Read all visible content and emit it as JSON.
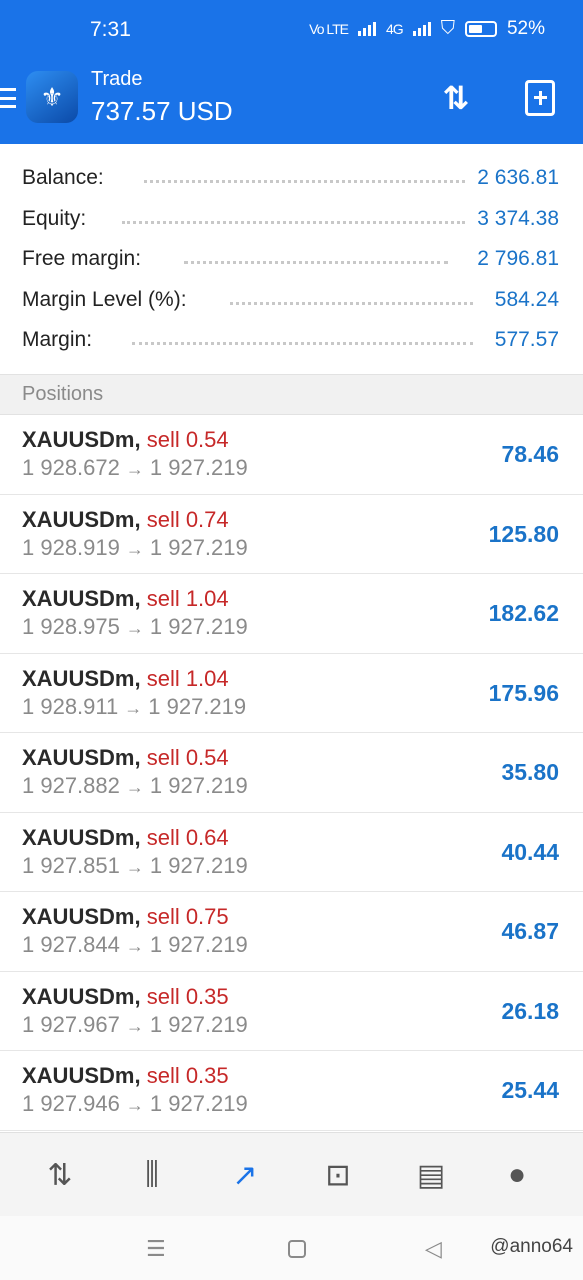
{
  "status_bar": {
    "time": "7:31",
    "network_icon": "volte-icon",
    "network_label": "Vo LTE",
    "network_type": "4G",
    "battery": "52%"
  },
  "header": {
    "title": "Trade",
    "value": "737.57 USD",
    "menu_icon": "hamburger-menu-icon",
    "sort_icon": "sort-arrows-icon",
    "new_order_icon": "new-order-icon"
  },
  "summary": [
    {
      "label": "Balance:",
      "value": "2 636.81"
    },
    {
      "label": "Equity:",
      "value": "3 374.38"
    },
    {
      "label": "Free margin:",
      "value": "2 796.81"
    },
    {
      "label": "Margin Level (%):",
      "value": "584.24"
    },
    {
      "label": "Margin:",
      "value": "577.57"
    }
  ],
  "positions_header": "Positions",
  "positions": [
    {
      "symbol": "XAUUSDm,",
      "direction": "sell 0.54",
      "open": "1 928.672",
      "arrow": "→",
      "current": "1 927.219",
      "profit": "78.46"
    },
    {
      "symbol": "XAUUSDm,",
      "direction": "sell 0.74",
      "open": "1 928.919",
      "arrow": "→",
      "current": "1 927.219",
      "profit": "125.80"
    },
    {
      "symbol": "XAUUSDm,",
      "direction": "sell 1.04",
      "open": "1 928.975",
      "arrow": "→",
      "current": "1 927.219",
      "profit": "182.62"
    },
    {
      "symbol": "XAUUSDm,",
      "direction": "sell 1.04",
      "open": "1 928.911",
      "arrow": "→",
      "current": "1 927.219",
      "profit": "175.96"
    },
    {
      "symbol": "XAUUSDm,",
      "direction": "sell 0.54",
      "open": "1 927.882",
      "arrow": "→",
      "current": "1 927.219",
      "profit": "35.80"
    },
    {
      "symbol": "XAUUSDm,",
      "direction": "sell 0.64",
      "open": "1 927.851",
      "arrow": "→",
      "current": "1 927.219",
      "profit": "40.44"
    },
    {
      "symbol": "XAUUSDm,",
      "direction": "sell 0.75",
      "open": "1 927.844",
      "arrow": "→",
      "current": "1 927.219",
      "profit": "46.87"
    },
    {
      "symbol": "XAUUSDm,",
      "direction": "sell 0.35",
      "open": "1 927.967",
      "arrow": "→",
      "current": "1 927.219",
      "profit": "26.18"
    },
    {
      "symbol": "XAUUSDm,",
      "direction": "sell 0.35",
      "open": "1 927.946",
      "arrow": "→",
      "current": "1 927.219",
      "profit": "25.44"
    }
  ],
  "tab_bar": [
    {
      "icon": "quotes-icon",
      "glyph": "⇅",
      "active": false
    },
    {
      "icon": "chart-icon",
      "glyph": "⫼",
      "active": false
    },
    {
      "icon": "trade-icon",
      "glyph": "↗",
      "active": true
    },
    {
      "icon": "history-icon",
      "glyph": "⊡",
      "active": false
    },
    {
      "icon": "news-icon",
      "glyph": "▤",
      "active": false
    },
    {
      "icon": "messages-icon",
      "glyph": "●",
      "active": false
    }
  ],
  "system_nav": {
    "menu_glyph": "☰",
    "back_glyph": "◁",
    "watermark": "@anno64"
  },
  "colors": {
    "accent": "#1a73e8",
    "value_blue": "#1a73c8",
    "sell_red": "#c62828"
  }
}
